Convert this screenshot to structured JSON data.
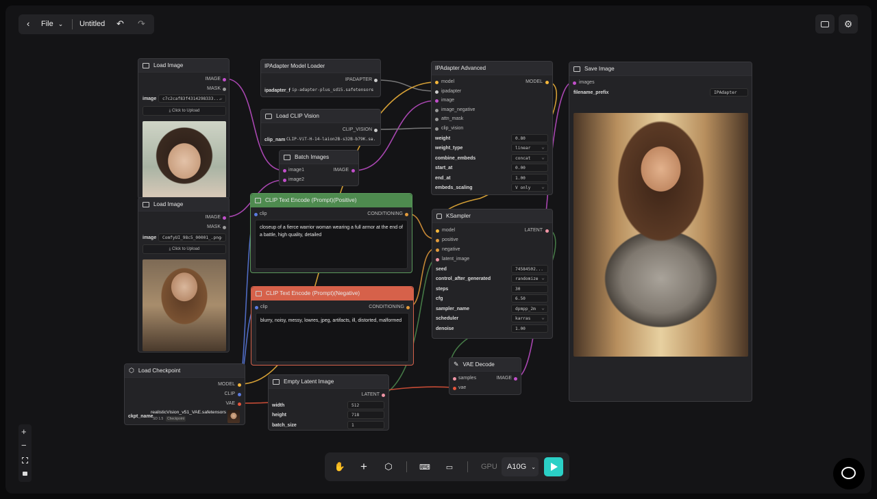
{
  "topbar": {
    "file_label": "File",
    "title": "Untitled"
  },
  "colors": {
    "model": "#f5b73b",
    "clip": "#f5d23b",
    "image": "#c24fcb",
    "ipadapter": "#888",
    "conditioning": "#e39b3b",
    "latent": "#f095a5",
    "vae": "#e5553b",
    "positive_header": "#4e8b4f",
    "negative_header": "#d6614a",
    "run_button": "#2bd0c6"
  },
  "nodes": {
    "load_image_1": {
      "title": "Load Image",
      "outputs": [
        "IMAGE",
        "MASK"
      ],
      "image_label": "image",
      "image_value": "c7c2caf83f4314298333...",
      "upload_label": "Click to Upload"
    },
    "load_image_2": {
      "title": "Load Image",
      "outputs": [
        "IMAGE",
        "MASK"
      ],
      "image_label": "image",
      "image_value": "ComfyUI_98c5_00001_.png",
      "upload_label": "Click to Upload"
    },
    "ipadapter_loader": {
      "title": "IPAdapter Model Loader",
      "output": "IPADAPTER",
      "widget_label": "ipadapter_f",
      "widget_value": "ip-adapter-plus_sd15.safetensors"
    },
    "clip_vision": {
      "title": "Load CLIP Vision",
      "output": "CLIP_VISION",
      "widget_label": "clip_nam",
      "widget_value": "CLIP-ViT-H-14-laion2B-s32B-b79K.sa..."
    },
    "batch_images": {
      "title": "Batch Images",
      "inputs": [
        "image1",
        "image2"
      ],
      "output": "IMAGE"
    },
    "ipadapter_adv": {
      "title": "IPAdapter Advanced",
      "inputs": [
        "model",
        "ipadapter",
        "image",
        "image_negative",
        "attn_mask",
        "clip_vision"
      ],
      "output": "MODEL",
      "widgets": [
        {
          "label": "weight",
          "value": "0.80"
        },
        {
          "label": "weight_type",
          "value": "linear"
        },
        {
          "label": "combine_embeds",
          "value": "concat"
        },
        {
          "label": "start_at",
          "value": "0.00"
        },
        {
          "label": "end_at",
          "value": "1.00"
        },
        {
          "label": "embeds_scaling",
          "value": "V only"
        }
      ]
    },
    "save_image": {
      "title": "Save Image",
      "input": "images",
      "widget_label": "filename_prefix",
      "widget_value": "IPAdapter"
    },
    "clip_pos": {
      "title": "CLIP Text Encode (Prompt)(Positive)",
      "input": "clip",
      "output": "CONDITIONING",
      "text": "closeup of a fierce warrior woman wearing a full armor at the end of a battle,  high quality, detailed"
    },
    "clip_neg": {
      "title": "CLIP Text Encode (Prompt)(Negative)",
      "input": "clip",
      "output": "CONDITIONING",
      "text": "blurry, noisy, messy, lowres, jpeg, artifacts, ill, distorted, malformed"
    },
    "ksampler": {
      "title": "KSampler",
      "inputs": [
        "model",
        "positive",
        "negative",
        "latent_image"
      ],
      "output": "LATENT",
      "widgets": [
        {
          "label": "seed",
          "value": "74584502..."
        },
        {
          "label": "control_after_generated",
          "value": "randomize"
        },
        {
          "label": "steps",
          "value": "30"
        },
        {
          "label": "cfg",
          "value": "6.50"
        },
        {
          "label": "sampler_name",
          "value": "dpmpp_2m"
        },
        {
          "label": "scheduler",
          "value": "karras"
        },
        {
          "label": "denoise",
          "value": "1.00"
        }
      ]
    },
    "vae_decode": {
      "title": "VAE Decode",
      "inputs": [
        "samples",
        "vae"
      ],
      "output": "IMAGE"
    },
    "load_checkpoint": {
      "title": "Load Checkpoint",
      "outputs": [
        "MODEL",
        "CLIP",
        "VAE"
      ],
      "widget_label": "ckpt_name",
      "widget_value": "realisticVision_v51_VAE.safetensors",
      "tag1": "SD 1.5",
      "tag2": "Checkpoint"
    },
    "empty_latent": {
      "title": "Empty Latent Image",
      "output": "LATENT",
      "widgets": [
        {
          "label": "width",
          "value": "512"
        },
        {
          "label": "height",
          "value": "718"
        },
        {
          "label": "batch_size",
          "value": "1"
        }
      ]
    }
  },
  "toolbar": {
    "gpu_label": "GPU",
    "gpu_value": "A10G"
  },
  "icons": [
    "back-icon",
    "chevron-down-icon",
    "undo-icon",
    "redo-icon",
    "panel-icon",
    "gear-icon",
    "zoom-in-icon",
    "zoom-out-icon",
    "fit-icon",
    "lock-icon",
    "hand-icon",
    "plus-icon",
    "cube-icon",
    "terminal-icon",
    "layout-icon",
    "play-icon",
    "chat-icon",
    "image-icon"
  ]
}
